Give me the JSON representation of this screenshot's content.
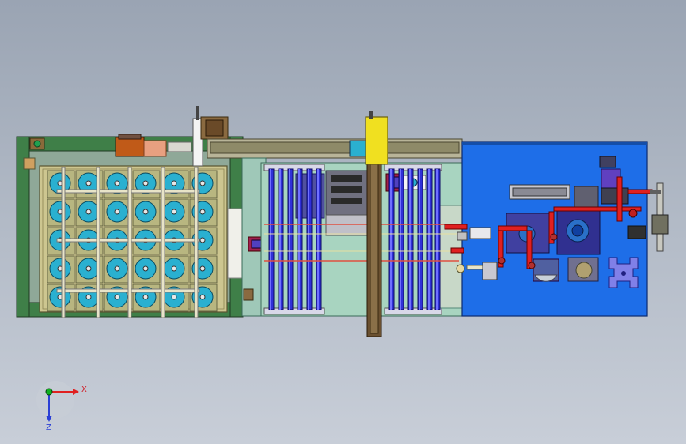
{
  "view": {
    "background": "#a8b0bd",
    "colors": {
      "frame_green": "#4a8a52",
      "plate_olive": "#c8c28e",
      "tray_cyan": "#2ab0d0",
      "rod_blue": "#3030d8",
      "station_blue": "#1e6ee8",
      "accent_yellow": "#f0e020",
      "rail_brown": "#6a5030",
      "red": "#e02020"
    }
  },
  "triad": {
    "x_label": "X",
    "z_label": "Z",
    "x_color": "#e02020",
    "z_color": "#2a3fd6",
    "y_color": "#10b020"
  },
  "tray_grid": {
    "rows": 5,
    "cols": 6
  }
}
